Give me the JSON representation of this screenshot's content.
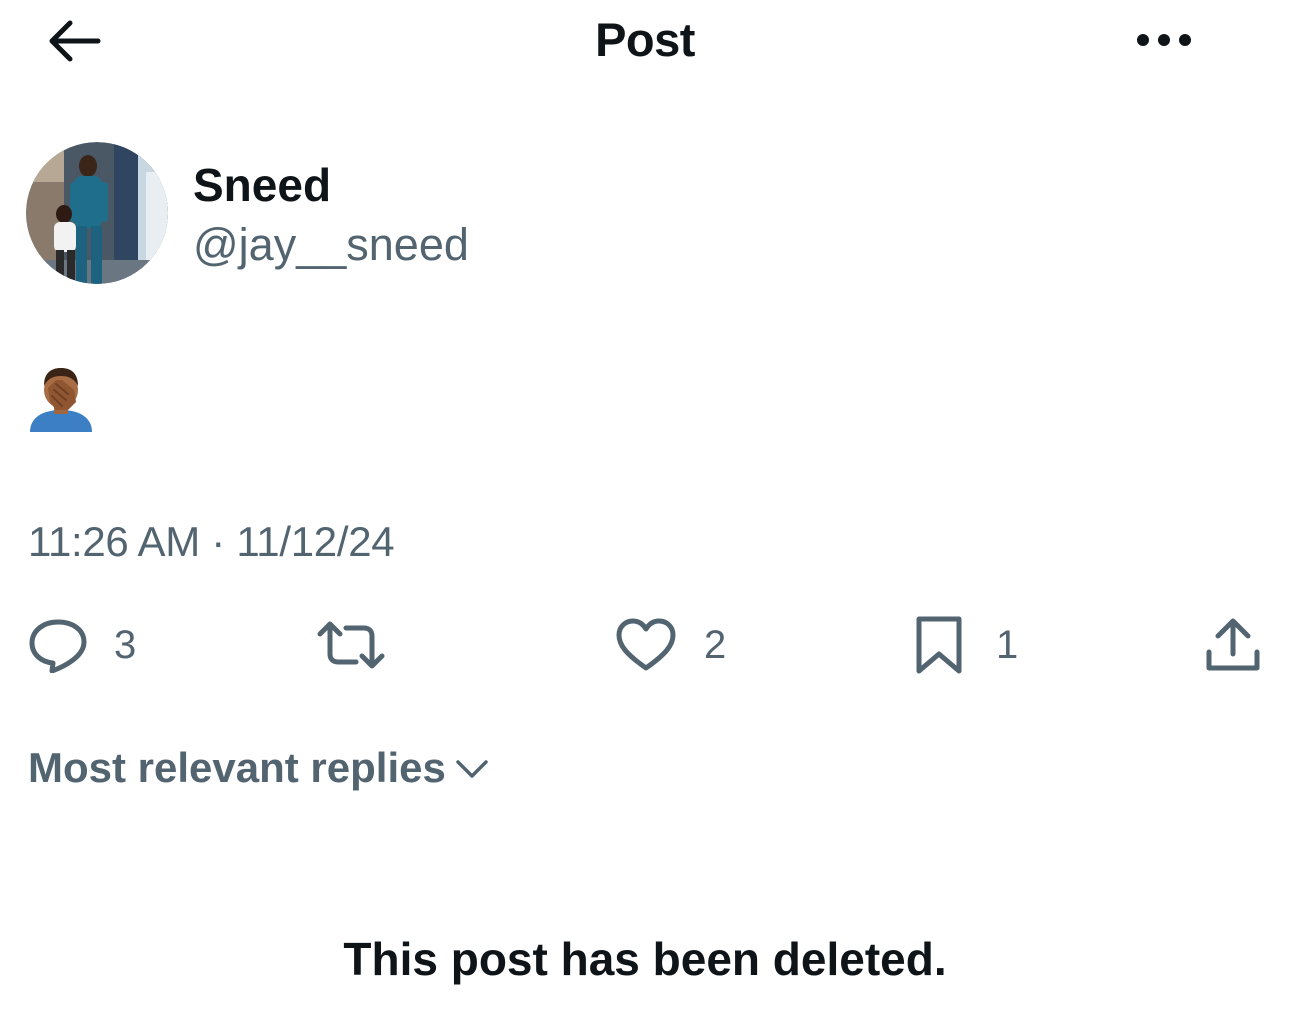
{
  "header": {
    "title": "Post",
    "back_icon": "arrow-left-icon",
    "more_icon": "more-horizontal-icon"
  },
  "author": {
    "display_name": "Sneed",
    "handle": "@jay__sneed"
  },
  "post": {
    "emoji": "🤦🏾‍♂️",
    "timestamp": "11:26 AM · 11/12/24"
  },
  "actions": {
    "replies": "3",
    "reposts": "",
    "likes": "2",
    "bookmarks": "1"
  },
  "replies_sort": {
    "label": "Most relevant replies"
  },
  "notice": "This post has been deleted.",
  "colors": {
    "text": "#0f1419",
    "secondary": "#536471",
    "background": "#ffffff"
  }
}
